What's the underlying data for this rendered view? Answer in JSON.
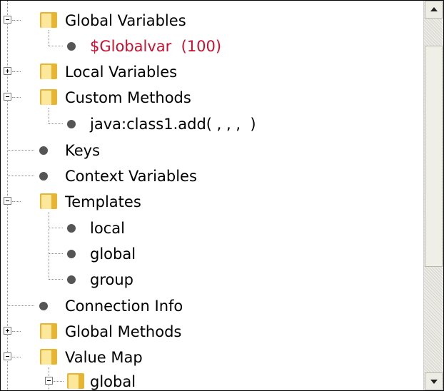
{
  "tree": {
    "items": [
      {
        "label": "Global Variables",
        "kind": "folder",
        "state": "expanded"
      },
      {
        "label": "$Globalvar  (100)",
        "kind": "leaf",
        "color": "#c8102e"
      },
      {
        "label": "Local Variables",
        "kind": "folder",
        "state": "collapsed"
      },
      {
        "label": "Custom Methods",
        "kind": "folder",
        "state": "expanded"
      },
      {
        "label": "java:class1.add( , , ,  )",
        "kind": "leaf"
      },
      {
        "label": "Keys",
        "kind": "leaf"
      },
      {
        "label": "Context Variables",
        "kind": "leaf"
      },
      {
        "label": "Templates",
        "kind": "folder",
        "state": "expanded"
      },
      {
        "label": "local",
        "kind": "leaf"
      },
      {
        "label": "global",
        "kind": "leaf"
      },
      {
        "label": "group",
        "kind": "leaf"
      },
      {
        "label": "Connection Info",
        "kind": "leaf"
      },
      {
        "label": "Global Methods",
        "kind": "folder",
        "state": "collapsed"
      },
      {
        "label": "Value Map",
        "kind": "folder",
        "state": "expanded"
      },
      {
        "label": "global",
        "kind": "folder",
        "state": "expanded"
      }
    ]
  },
  "icons": {
    "folder": "folder-icon",
    "leaf": "bullet-icon",
    "expanded": "minus-expander-icon",
    "collapsed": "plus-expander-icon",
    "scroll_up": "arrow-up-icon",
    "scroll_down": "arrow-down-icon"
  },
  "colors": {
    "folder_light": "#fde79a",
    "folder_dark": "#e6b531",
    "highlight_text": "#c8102e"
  }
}
